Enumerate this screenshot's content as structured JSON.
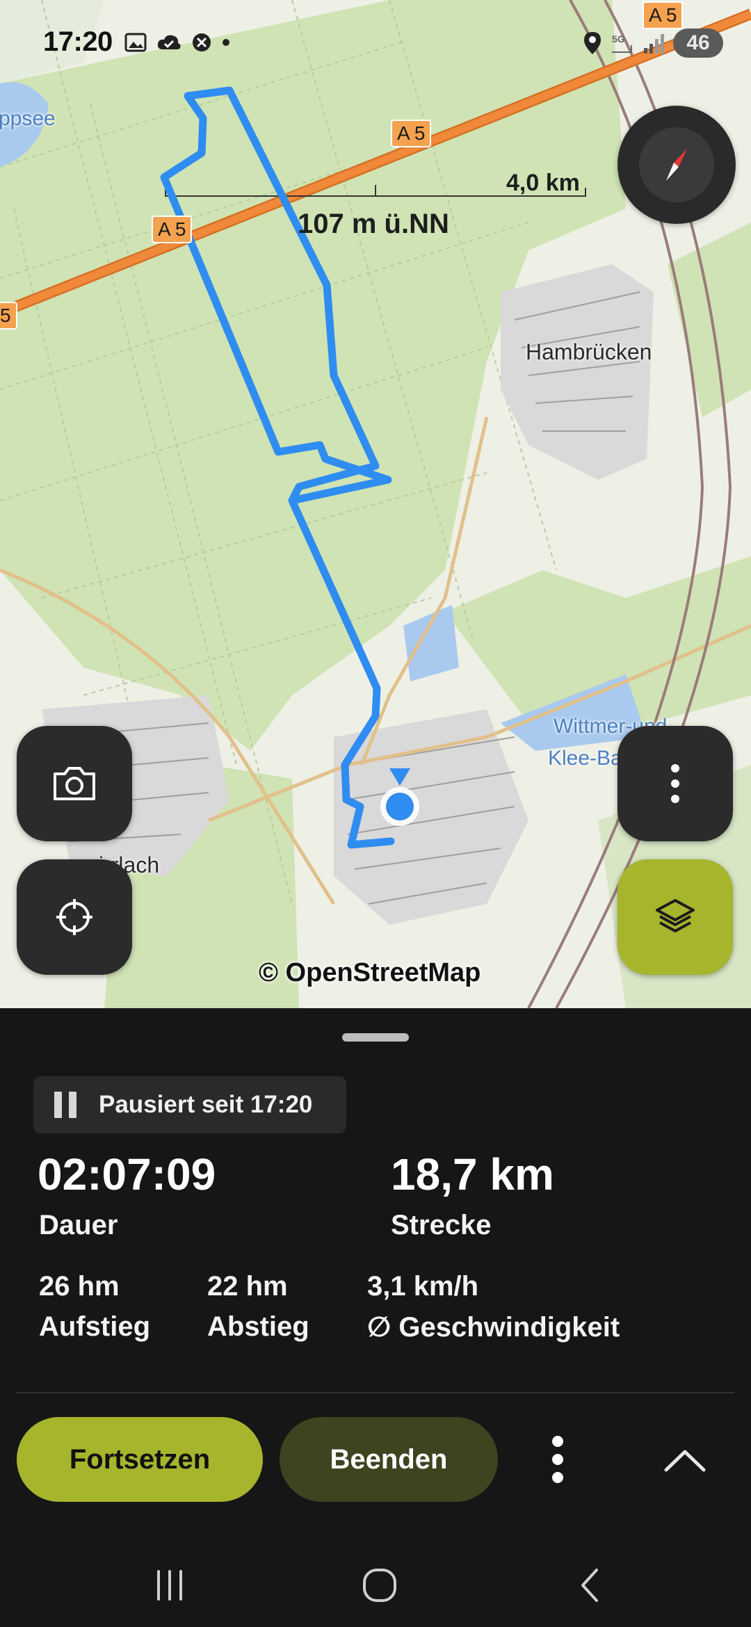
{
  "status_bar": {
    "time": "17:20",
    "battery": "46"
  },
  "map": {
    "scale_label": "4,0 km",
    "elevation_label": "107 m ü.NN",
    "road_shields": [
      "A 5",
      "A 5",
      "A 5",
      "A 5"
    ],
    "partial_shield": "5",
    "places": [
      "Hambrücken",
      "irrlach"
    ],
    "water_labels": [
      "ppsee",
      "Wittmer-und",
      "Klee-Bag"
    ],
    "attribution": "© OpenStreetMap",
    "colors": {
      "track": "#2f8cf0",
      "forest": "#cfe3b4",
      "motorway": "#f08a3a",
      "water": "#a9c9ee"
    }
  },
  "controls": {
    "camera_icon": "camera-icon",
    "locate_icon": "crosshair-icon",
    "menu_icon": "more-vertical-icon",
    "layers_icon": "layers-icon",
    "compass_icon": "compass-icon"
  },
  "recording": {
    "paused_text": "Pausiert seit 17:20",
    "duration": {
      "value": "02:07:09",
      "label": "Dauer"
    },
    "distance": {
      "value": "18,7 km",
      "label": "Strecke"
    },
    "ascent": {
      "value": "26 hm",
      "label": "Aufstieg"
    },
    "descent": {
      "value": "22 hm",
      "label": "Abstieg"
    },
    "speed": {
      "value": "3,1 km/h",
      "label": "∅ Geschwindigkeit"
    }
  },
  "actions": {
    "resume": "Fortsetzen",
    "end": "Beenden"
  },
  "accent_color": "#a6b52c"
}
